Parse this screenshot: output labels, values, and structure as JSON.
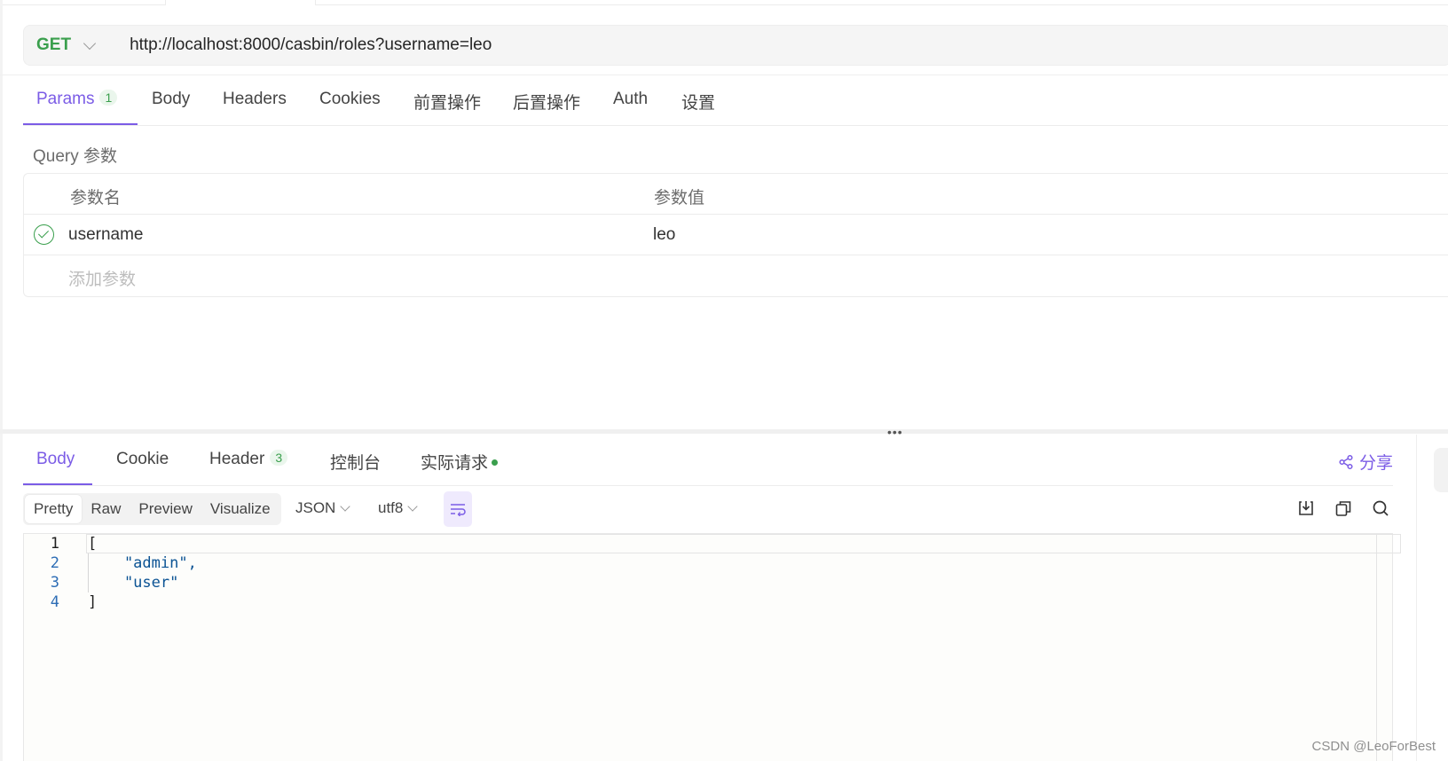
{
  "request": {
    "method": "GET",
    "url": "http://localhost:8000/casbin/roles?username=leo",
    "tabs": [
      {
        "label": "Params",
        "badge": "1"
      },
      {
        "label": "Body"
      },
      {
        "label": "Headers"
      },
      {
        "label": "Cookies"
      },
      {
        "label": "前置操作"
      },
      {
        "label": "后置操作"
      },
      {
        "label": "Auth"
      },
      {
        "label": "设置"
      }
    ],
    "active_tab": "Params"
  },
  "params": {
    "section_label": "Query 参数",
    "col_name": "参数名",
    "col_value": "参数值",
    "rows": [
      {
        "enabled": true,
        "name": "username",
        "value": "leo"
      }
    ],
    "add_placeholder": "添加参数"
  },
  "response": {
    "tabs": [
      {
        "label": "Body"
      },
      {
        "label": "Cookie"
      },
      {
        "label": "Header",
        "badge": "3"
      },
      {
        "label": "控制台"
      },
      {
        "label": "实际请求"
      }
    ],
    "active_tab": "Body",
    "share_label": "分享",
    "view_modes": [
      "Pretty",
      "Raw",
      "Preview",
      "Visualize"
    ],
    "active_view": "Pretty",
    "format": "JSON",
    "encoding": "utf8",
    "code_lines": [
      {
        "num": "1",
        "text": "["
      },
      {
        "num": "2",
        "text": "    \"admin\","
      },
      {
        "num": "3",
        "text": "    \"user\""
      },
      {
        "num": "4",
        "text": "]"
      }
    ]
  },
  "watermark": "CSDN @LeoForBest",
  "colors": {
    "accent": "#7b5ce6",
    "method_get": "#3a9f4d",
    "json_string": "#0b5394"
  },
  "icons": [
    "chevron-down-icon",
    "check-circle-icon",
    "share-icon",
    "wrap-lines-icon",
    "download-icon",
    "copy-icon",
    "search-icon",
    "drag-handle-icon"
  ]
}
